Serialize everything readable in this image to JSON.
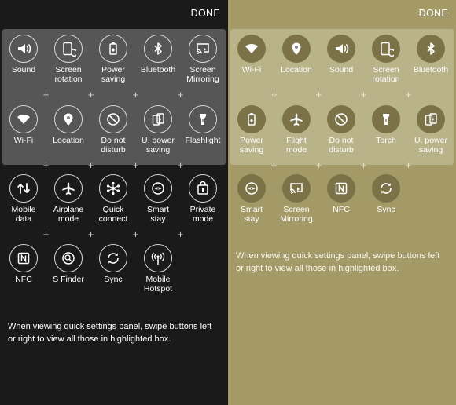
{
  "done_label": "DONE",
  "hint_text": "When viewing quick settings panel, swipe buttons left or right to view all those in highlighted box.",
  "colors": {
    "dark_background": "#1a1a1a",
    "dark_highlight": "#565656",
    "olive_background": "#a39a68",
    "olive_highlight": "#b9b38a",
    "olive_icon_circle": "#7b7347"
  },
  "left": {
    "tiles": [
      {
        "label": "Sound",
        "icon": "speaker-icon"
      },
      {
        "label": "Screen\nrotation",
        "icon": "screen-rotation-icon"
      },
      {
        "label": "Power\nsaving",
        "icon": "power-saving-icon"
      },
      {
        "label": "Bluetooth",
        "icon": "bluetooth-icon"
      },
      {
        "label": "Screen\nMirroring",
        "icon": "screen-mirroring-icon"
      },
      {
        "label": "Wi-Fi",
        "icon": "wifi-icon"
      },
      {
        "label": "Location",
        "icon": "location-icon"
      },
      {
        "label": "Do not\ndisturb",
        "icon": "do-not-disturb-icon"
      },
      {
        "label": "U. power\nsaving",
        "icon": "ultra-power-saving-icon"
      },
      {
        "label": "Flashlight",
        "icon": "flashlight-icon"
      },
      {
        "label": "Mobile\ndata",
        "icon": "mobile-data-icon"
      },
      {
        "label": "Airplane\nmode",
        "icon": "airplane-icon"
      },
      {
        "label": "Quick\nconnect",
        "icon": "quick-connect-icon"
      },
      {
        "label": "Smart\nstay",
        "icon": "smart-stay-icon"
      },
      {
        "label": "Private\nmode",
        "icon": "private-mode-icon"
      },
      {
        "label": "NFC",
        "icon": "nfc-icon"
      },
      {
        "label": "S Finder",
        "icon": "s-finder-icon"
      },
      {
        "label": "Sync",
        "icon": "sync-icon"
      },
      {
        "label": "Mobile\nHotspot",
        "icon": "mobile-hotspot-icon"
      }
    ]
  },
  "right": {
    "tiles": [
      {
        "label": "Wi-Fi",
        "icon": "wifi-icon"
      },
      {
        "label": "Location",
        "icon": "location-icon"
      },
      {
        "label": "Sound",
        "icon": "speaker-icon"
      },
      {
        "label": "Screen\nrotation",
        "icon": "screen-rotation-icon"
      },
      {
        "label": "Bluetooth",
        "icon": "bluetooth-icon"
      },
      {
        "label": "Power\nsaving",
        "icon": "power-saving-icon"
      },
      {
        "label": "Flight\nmode",
        "icon": "airplane-icon"
      },
      {
        "label": "Do not\ndisturb",
        "icon": "do-not-disturb-icon"
      },
      {
        "label": "Torch",
        "icon": "flashlight-icon"
      },
      {
        "label": "U. power\nsaving",
        "icon": "ultra-power-saving-icon"
      },
      {
        "label": "Smart\nstay",
        "icon": "smart-stay-icon"
      },
      {
        "label": "Screen\nMirroring",
        "icon": "screen-mirroring-icon"
      },
      {
        "label": "NFC",
        "icon": "nfc-icon"
      },
      {
        "label": "Sync",
        "icon": "sync-icon"
      }
    ]
  }
}
